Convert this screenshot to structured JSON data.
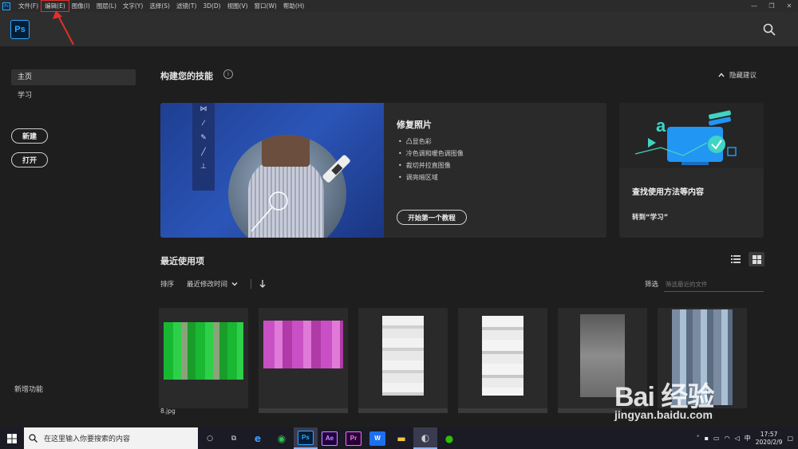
{
  "menubar": {
    "items": [
      "文件(F)",
      "编辑(E)",
      "图像(I)",
      "图层(L)",
      "文字(Y)",
      "选择(S)",
      "滤镜(T)",
      "3D(D)",
      "视图(V)",
      "窗口(W)",
      "帮助(H)"
    ],
    "highlighted_index": 1,
    "highlight_color": "#e0302a"
  },
  "app": {
    "logo": "Ps",
    "brand_color": "#31a8ff"
  },
  "sidebar": {
    "home": "主页",
    "learn": "学习",
    "new_button": "新建",
    "open_button": "打开",
    "new_features": "新增功能"
  },
  "skills": {
    "title": "构建您的技能",
    "hide_tips": "隐藏建议",
    "hero": {
      "title": "修复照片",
      "bullets": [
        "凸显色彩",
        "冷色调和暖色调图像",
        "裁切并拉直图像",
        "调亮暗区域"
      ],
      "button": "开始第一个教程"
    },
    "learn_card": {
      "title": "查找使用方法等内容",
      "link": "转到“学习”"
    }
  },
  "recent": {
    "title": "最近使用项",
    "sort_label": "排序",
    "sort_value": "最近修改时间",
    "filter_label": "筛选",
    "filter_placeholder": "筛选最近的文件",
    "first_file_name": "8.jpg"
  },
  "taskbar": {
    "search_placeholder": "在这里输入你要搜索的内容",
    "apps": [
      "Ps",
      "Ae",
      "Pr",
      "W"
    ],
    "ime": "中",
    "time": "17:57",
    "date": "2020/2/9"
  },
  "watermark": {
    "brand": "Bai 经验",
    "url": "jingyan.baidu.com"
  }
}
